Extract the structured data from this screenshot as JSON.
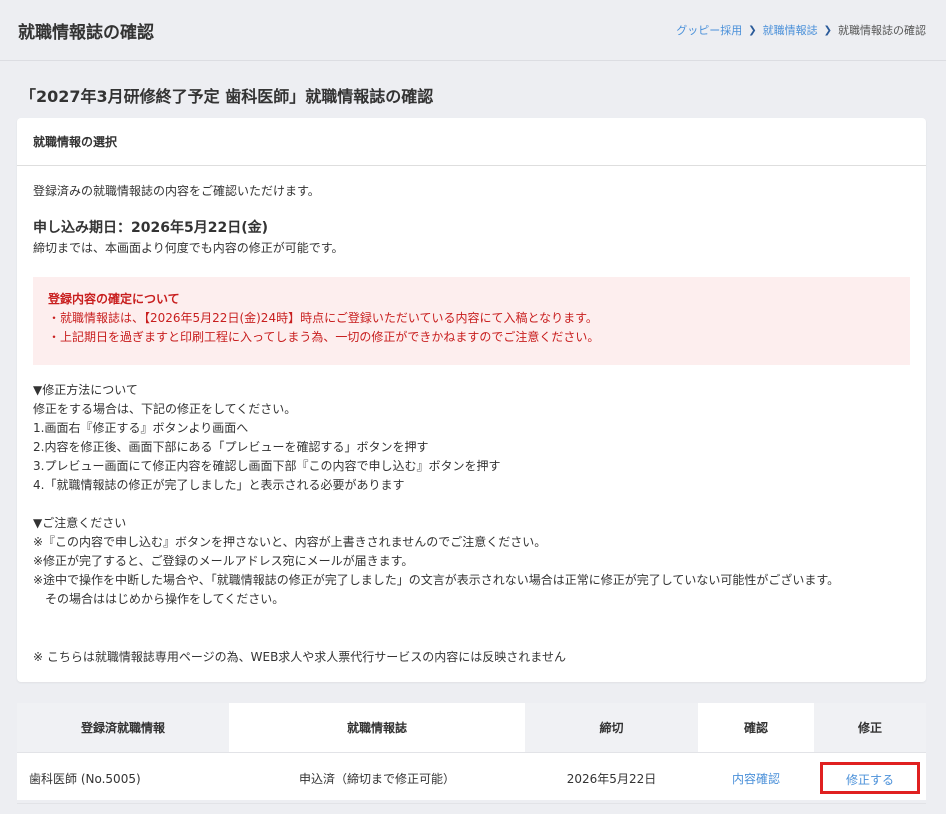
{
  "header": {
    "title": "就職情報誌の確認",
    "breadcrumb": [
      "グッピー採用",
      "就職情報誌",
      "就職情報誌の確認"
    ]
  },
  "page_heading": "「2027年3月研修終了予定 歯科医師」就職情報誌の確認",
  "card": {
    "header": "就職情報の選択",
    "intro": "登録済みの就職情報誌の内容をご確認いただけます。",
    "deadline": "申し込み期日：2026年5月22日(金)",
    "deadline_note": "締切までは、本画面より何度でも内容の修正が可能です。",
    "alert": {
      "title": "登録内容の確定について",
      "lines": [
        "・就職情報誌は、【2026年5月22日(金)24時】時点にご登録いただいている内容にて入稿となります。",
        "・上記期日を過ぎますと印刷工程に入ってしまう為、一切の修正ができかねますのでご注意ください。"
      ]
    },
    "method": {
      "title": "▼修正方法について",
      "lines": [
        "修正をする場合は、下記の修正をしてください。",
        "1.画面右『修正する』ボタンより画面へ",
        "2.内容を修正後、画面下部にある「プレビューを確認する」ボタンを押す",
        "3.プレビュー画面にて修正内容を確認し画面下部『この内容で申し込む』ボタンを押す",
        "4.「就職情報誌の修正が完了しました」と表示される必要があります"
      ]
    },
    "caution": {
      "title": "▼ご注意ください",
      "lines": [
        "※『この内容で申し込む』ボタンを押さないと、内容が上書きされませんのでご注意ください。",
        "※修正が完了すると、ご登録のメールアドレス宛にメールが届きます。",
        "※途中で操作を中断した場合や、「就職情報誌の修正が完了しました」の文言が表示されない場合は正常に修正が完了していない可能性がございます。",
        "　その場合ははじめから操作をしてください。"
      ]
    },
    "footnote": "※ こちらは就職情報誌専用ページの為、WEB求人や求人票代行サービスの内容には反映されません"
  },
  "table": {
    "headers": [
      "登録済就職情報",
      "就職情報誌",
      "締切",
      "確認",
      "修正"
    ],
    "row": {
      "name": "歯科医師 (No.5005)",
      "status": "申込済（締切まで修正可能）",
      "deadline": "2026年5月22日",
      "confirm": "内容確認",
      "edit": "修正する"
    }
  }
}
